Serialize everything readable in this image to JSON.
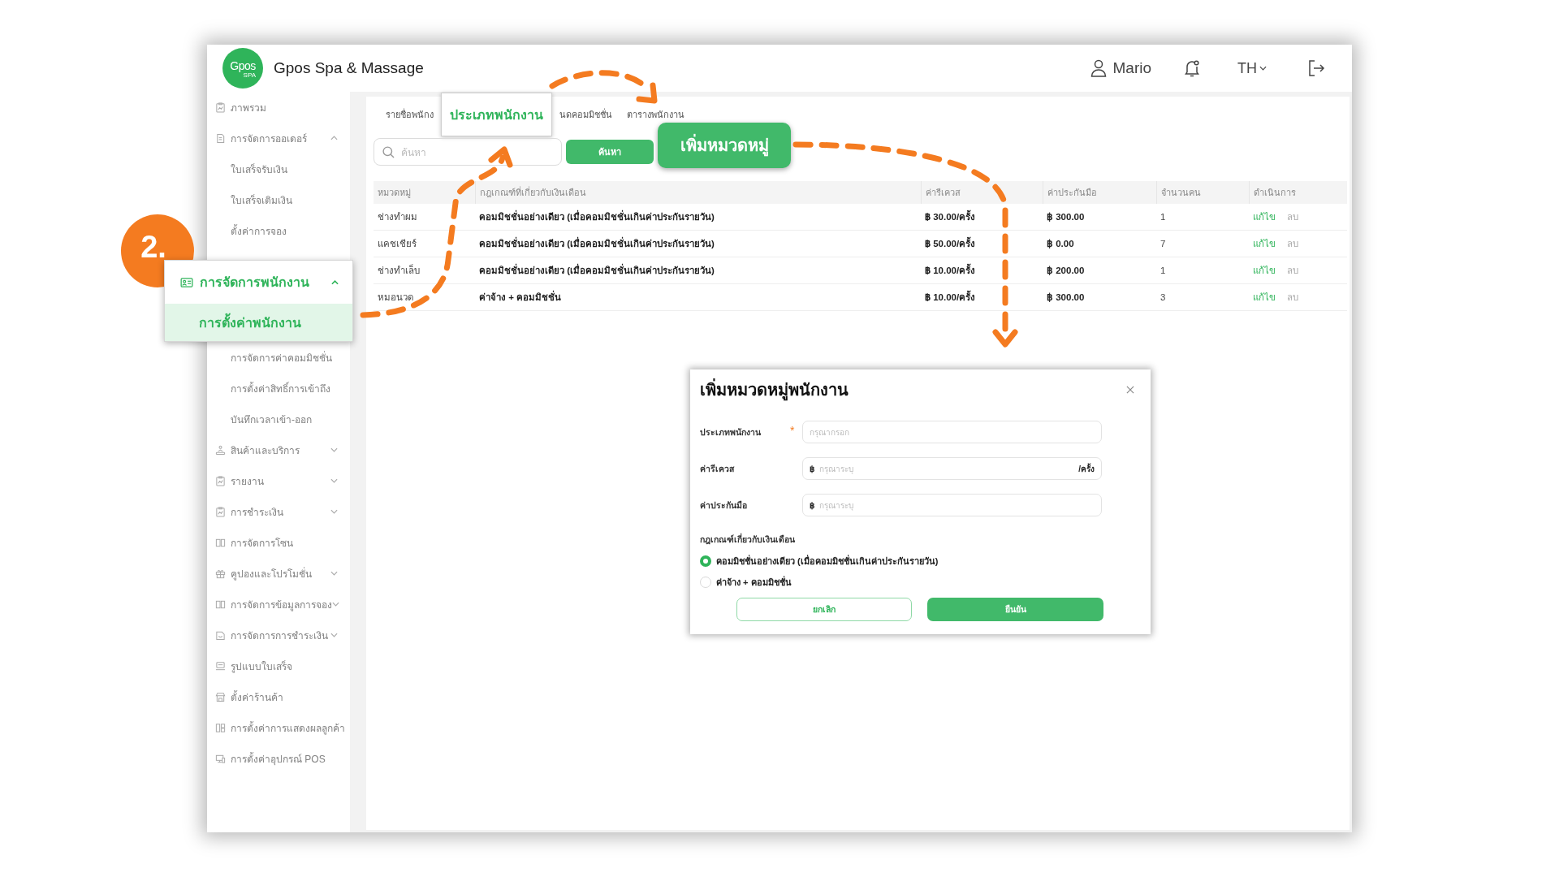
{
  "header": {
    "logo_text": "Gpos",
    "logo_subtext": "SPA",
    "title": "Gpos Spa & Massage",
    "user": "Mario",
    "language": "TH"
  },
  "step_badge": "2.",
  "sidebar": {
    "items": [
      {
        "label": "ภาพรวม",
        "selected": false,
        "highlighted": false
      },
      {
        "label": "การจัดการออเดอร์",
        "selected": false,
        "highlighted": false,
        "expanded": true,
        "children": [
          {
            "label": "ใบเสร็จรับเงิน",
            "selected": false,
            "highlighted": false
          },
          {
            "label": "ใบเสร็จเติมเงิน",
            "selected": false,
            "highlighted": false
          },
          {
            "label": "ตั้งค่าการจอง",
            "selected": false,
            "highlighted": false
          }
        ]
      },
      {
        "label": "การจัดการพนักงาน",
        "selected": false,
        "highlighted": true,
        "expanded": true,
        "children": [
          {
            "label": "การตั้งค่าพนักงาน",
            "selected": true,
            "highlighted": true
          },
          {
            "label": "การจัดการค่าคอมมิชชั่น",
            "selected": false,
            "highlighted": false
          },
          {
            "label": "การตั้งค่าสิทธิ์การเข้าถึง",
            "selected": false,
            "highlighted": false
          },
          {
            "label": "บันทึกเวลาเข้า-ออก",
            "selected": false,
            "highlighted": false
          }
        ]
      },
      {
        "label": "สินค้าและบริการ",
        "selected": false,
        "highlighted": false,
        "expanded": false
      },
      {
        "label": "รายงาน",
        "selected": false,
        "highlighted": false,
        "expanded": false
      },
      {
        "label": "การชำระเงิน",
        "selected": false,
        "highlighted": false,
        "expanded": false
      },
      {
        "label": "การจัดการโซน",
        "selected": false,
        "highlighted": false
      },
      {
        "label": "คูปองและโปรโมชั่น",
        "selected": false,
        "highlighted": false,
        "expanded": false
      },
      {
        "label": "การจัดการข้อมูลการจอง",
        "selected": false,
        "highlighted": false,
        "expanded": false
      },
      {
        "label": "การจัดการการชำระเงิน",
        "selected": false,
        "highlighted": false,
        "expanded": false
      },
      {
        "label": "รูปแบบใบเสร็จ",
        "selected": false,
        "highlighted": false
      },
      {
        "label": "ตั้งค่าร้านค้า",
        "selected": false,
        "highlighted": false
      },
      {
        "label": "การตั้งค่าการแสดงผลลูกค้า",
        "selected": false,
        "highlighted": false
      },
      {
        "label": "การตั้งค่าอุปกรณ์ POS",
        "selected": false,
        "highlighted": false
      }
    ]
  },
  "tabs": [
    {
      "label": "รายชื่อพนักง",
      "selected": false,
      "highlighted": false
    },
    {
      "label": "ประเภทพนักงาน",
      "selected": true,
      "highlighted": true
    },
    {
      "label": "นดคอมมิชชั่น",
      "selected": false,
      "highlighted": false
    },
    {
      "label": "ตารางพนักงาน",
      "selected": false,
      "highlighted": false
    }
  ],
  "search": {
    "placeholder": "ค้นหา",
    "button": "ค้นหา"
  },
  "add_button": {
    "label": "เพิ่มหมวดหมู่",
    "highlighted": true
  },
  "table": {
    "columns": [
      "หมวดหมู่",
      "กฎเกณฑ์ที่เกี่ยวกับเงินเดือน",
      "ค่ารีเควส",
      "ค่าประกันมือ",
      "จำนวนคน",
      "ดำเนินการ"
    ],
    "rows": [
      {
        "category": "ช่างทำผม",
        "rule": "คอมมิชชั่นอย่างเดียว (เมื่อคอมมิชชั่นเกินค่าประกันรายวัน)",
        "request_fee": "฿ 30.00/ครั้ง",
        "guarantee": "฿ 300.00",
        "headcount": "1",
        "edit": "แก้ไข",
        "delete": "ลบ"
      },
      {
        "category": "แคชเชียร์",
        "rule": "คอมมิชชั่นอย่างเดียว (เมื่อคอมมิชชั่นเกินค่าประกันรายวัน)",
        "request_fee": "฿ 50.00/ครั้ง",
        "guarantee": "฿ 0.00",
        "headcount": "7",
        "edit": "แก้ไข",
        "delete": "ลบ"
      },
      {
        "category": "ช่างทำเล็บ",
        "rule": "คอมมิชชั่นอย่างเดียว (เมื่อคอมมิชชั่นเกินค่าประกันรายวัน)",
        "request_fee": "฿ 10.00/ครั้ง",
        "guarantee": "฿ 200.00",
        "headcount": "1",
        "edit": "แก้ไข",
        "delete": "ลบ"
      },
      {
        "category": "หมอนวด",
        "rule": "ค่าจ้าง + คอมมิชชั่น",
        "request_fee": "฿ 10.00/ครั้ง",
        "guarantee": "฿ 300.00",
        "headcount": "3",
        "edit": "แก้ไข",
        "delete": "ลบ"
      }
    ]
  },
  "modal": {
    "title": "เพิ่มหมวดหมู่พนักงาน",
    "fields": [
      {
        "label": "ประเภทพนักงาน",
        "required_mark": "*",
        "placeholder": "กรุณากรอก"
      },
      {
        "label": "ค่ารีเควส",
        "prefix": "฿",
        "placeholder": "กรุณาระบุ",
        "suffix": "/ครั้ง"
      },
      {
        "label": "ค่าประกันมือ",
        "prefix": "฿",
        "placeholder": "กรุณาระบุ"
      }
    ],
    "rule_label": "กฎเกณฑ์เกี่ยวกับเงินเดือน",
    "options": [
      {
        "label": "คอมมิชชั่นอย่างเดียว (เมื่อคอมมิชชั่นเกินค่าประกันรายวัน)",
        "selected": true
      },
      {
        "label": "ค่าจ้าง + คอมมิชชั่น",
        "selected": false
      }
    ],
    "cancel": "ยกเลิก",
    "confirm": "ยืนยัน"
  }
}
